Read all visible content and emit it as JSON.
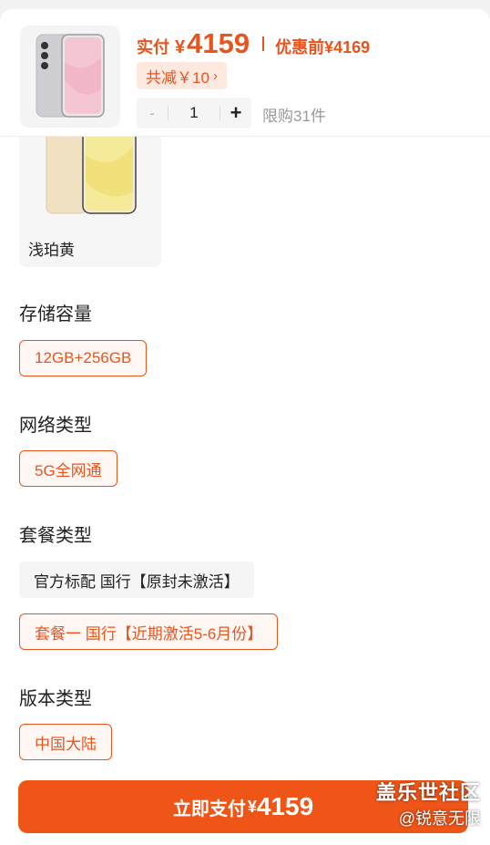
{
  "header": {
    "paid_label": "实付",
    "currency": "¥",
    "paid_amount": "4159",
    "before_label": "优惠前¥4169",
    "discount_label": "共减￥10",
    "discount_chevron": "›",
    "quantity": "1",
    "minus": "-",
    "plus": "+",
    "limit_text": "限购31件",
    "thumb_colors": [
      "#d9d9dc",
      "#f3c6d2"
    ]
  },
  "color_option": {
    "name": "浅珀黄",
    "device_color": "#efe1c2",
    "screen_color": "#f5ea9a"
  },
  "sections": {
    "storage": {
      "title": "存储容量",
      "options": [
        "12GB+256GB"
      ]
    },
    "network": {
      "title": "网络类型",
      "options": [
        "5G全网通"
      ]
    },
    "package": {
      "title": "套餐类型",
      "options": [
        "官方标配 国行【原封未激活】",
        "套餐一 国行【近期激活5-6月份】"
      ]
    },
    "version": {
      "title": "版本类型",
      "options": [
        "中国大陆"
      ]
    }
  },
  "buy_button": {
    "label": "立即支付",
    "currency": "¥",
    "amount": "4159"
  },
  "watermark": {
    "line1": "盖乐世社区",
    "line2": "@锐意无限"
  },
  "colors": {
    "accent": "#e8541e",
    "button": "#f05518",
    "accent_bg": "#fde9df"
  }
}
